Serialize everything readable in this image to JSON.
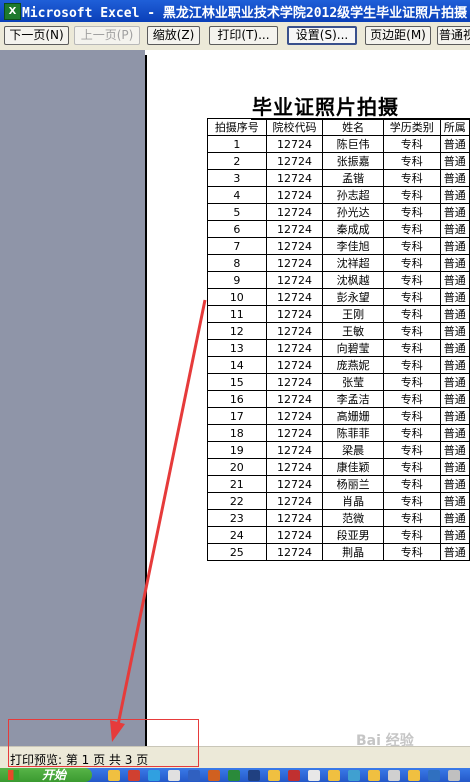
{
  "window": {
    "title": "Microsoft Excel - 黑龙江林业职业技术学院2012级学生毕业证照片拍摄"
  },
  "toolbar": {
    "next": "下一页(N)",
    "prev": "上一页(P)",
    "zoom": "缩放(Z)",
    "print": "打印(T)...",
    "setup": "设置(S)...",
    "margins": "页边距(M)",
    "normal_view": "普通视"
  },
  "document": {
    "title": "毕业证照片拍摄",
    "headers": [
      "拍摄序号",
      "院校代码",
      "姓名",
      "学历类别",
      "所属"
    ],
    "rows": [
      [
        "1",
        "12724",
        "陈巨伟",
        "专科",
        "普通"
      ],
      [
        "2",
        "12724",
        "张振嘉",
        "专科",
        "普通"
      ],
      [
        "3",
        "12724",
        "孟锴",
        "专科",
        "普通"
      ],
      [
        "4",
        "12724",
        "孙志超",
        "专科",
        "普通"
      ],
      [
        "5",
        "12724",
        "孙光达",
        "专科",
        "普通"
      ],
      [
        "6",
        "12724",
        "秦成成",
        "专科",
        "普通"
      ],
      [
        "7",
        "12724",
        "李佳旭",
        "专科",
        "普通"
      ],
      [
        "8",
        "12724",
        "沈祥超",
        "专科",
        "普通"
      ],
      [
        "9",
        "12724",
        "沈枫越",
        "专科",
        "普通"
      ],
      [
        "10",
        "12724",
        "彭永望",
        "专科",
        "普通"
      ],
      [
        "11",
        "12724",
        "王刚",
        "专科",
        "普通"
      ],
      [
        "12",
        "12724",
        "王敏",
        "专科",
        "普通"
      ],
      [
        "13",
        "12724",
        "向碧莹",
        "专科",
        "普通"
      ],
      [
        "14",
        "12724",
        "庞燕妮",
        "专科",
        "普通"
      ],
      [
        "15",
        "12724",
        "张莹",
        "专科",
        "普通"
      ],
      [
        "16",
        "12724",
        "李孟洁",
        "专科",
        "普通"
      ],
      [
        "17",
        "12724",
        "高姗姗",
        "专科",
        "普通"
      ],
      [
        "18",
        "12724",
        "陈菲菲",
        "专科",
        "普通"
      ],
      [
        "19",
        "12724",
        "梁晨",
        "专科",
        "普通"
      ],
      [
        "20",
        "12724",
        "康佳颖",
        "专科",
        "普通"
      ],
      [
        "21",
        "12724",
        "杨丽兰",
        "专科",
        "普通"
      ],
      [
        "22",
        "12724",
        "肖晶",
        "专科",
        "普通"
      ],
      [
        "23",
        "12724",
        "范微",
        "专科",
        "普通"
      ],
      [
        "24",
        "12724",
        "段亚男",
        "专科",
        "普通"
      ],
      [
        "25",
        "12724",
        "荆晶",
        "专科",
        "普通"
      ]
    ]
  },
  "status": {
    "text": "打印预览: 第 1 页  共 3 页"
  },
  "taskbar": {
    "start_label": "开始"
  },
  "watermark": {
    "text": "Bai 经验"
  },
  "colors": {
    "title_bar": "#0a3fb8",
    "toolbar_bg": "#ece9d8",
    "preview_gray": "#8f95a8",
    "annotation_red": "#e63b3b",
    "taskbar": "#2458c8"
  }
}
